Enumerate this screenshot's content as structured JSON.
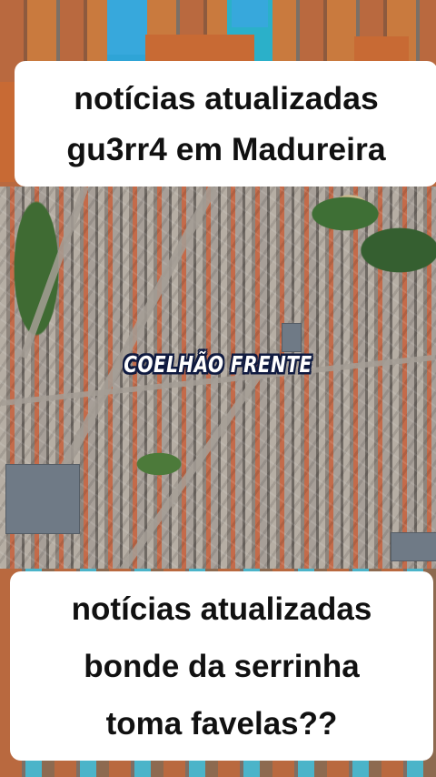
{
  "header_caption": {
    "line1": "notícias atualizadas",
    "line2": "gu3rr4 em Madureira"
  },
  "watermark": "COELHÃO FRENTE",
  "footer_caption": {
    "line1": "notícias atualizadas",
    "line2": "bonde da serrinha",
    "line3": "toma favelas??"
  },
  "colors": {
    "caption_bg": "#ffffff",
    "caption_text": "#111111",
    "watermark_text": "#ffffff",
    "watermark_outline": "#0f1a40"
  }
}
